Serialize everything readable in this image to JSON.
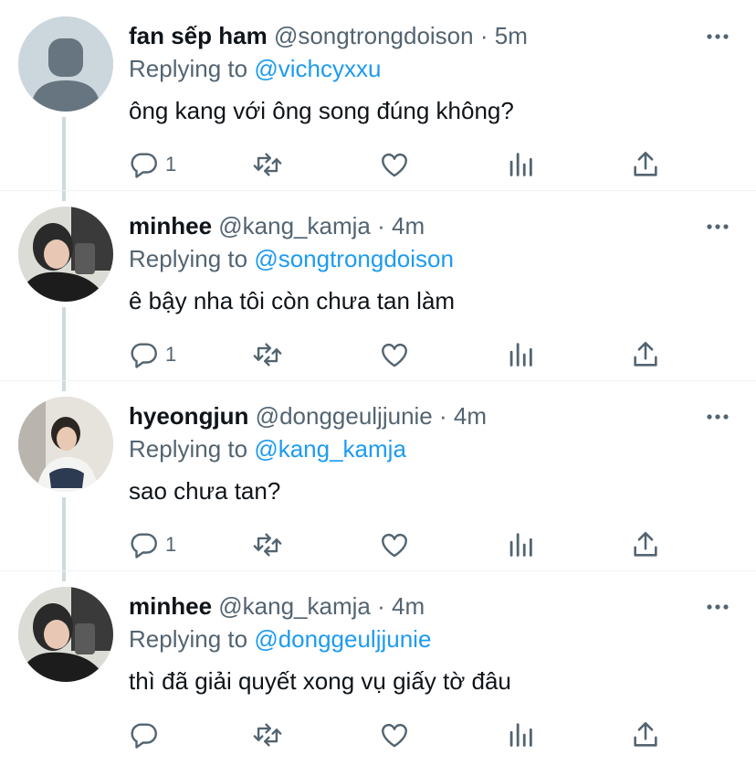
{
  "replying_prefix": "Replying to",
  "tweets": [
    {
      "name": "fan sếp ham",
      "handle": "@songtrongdoison",
      "dot": "·",
      "time": "5m",
      "replying_to": "@vichcyxxu",
      "text": "ông kang với ông song đúng không?",
      "reply_count": "1",
      "avatar": "default-avatar"
    },
    {
      "name": "minhee",
      "handle": "@kang_kamja",
      "dot": "·",
      "time": "4m",
      "replying_to": "@songtrongdoison",
      "text": "ê bậy nha tôi còn chưa tan làm",
      "reply_count": "1",
      "avatar": "photo-avatar-minhee"
    },
    {
      "name": "hyeongjun",
      "handle": "@donggeuljjunie",
      "dot": "·",
      "time": "4m",
      "replying_to": "@kang_kamja",
      "text": "sao chưa tan?",
      "reply_count": "1",
      "avatar": "photo-avatar-hyeongjun"
    },
    {
      "name": "minhee",
      "handle": "@kang_kamja",
      "dot": "·",
      "time": "4m",
      "replying_to": "@donggeuljjunie",
      "text": "thì đã giải quyết xong vụ giấy tờ đâu",
      "reply_count": "",
      "avatar": "photo-avatar-minhee"
    }
  ],
  "colors": {
    "link": "#1d9bf0",
    "secondary_text": "#536471",
    "thread_line": "#cfd9de"
  }
}
